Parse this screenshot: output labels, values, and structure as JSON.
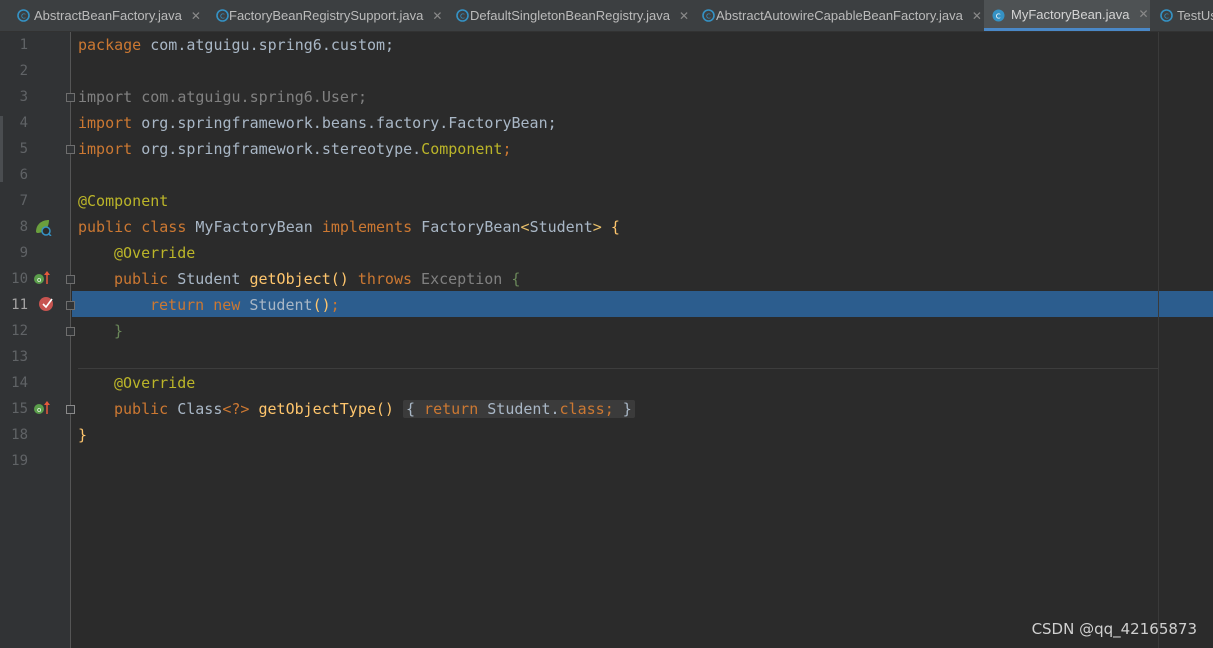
{
  "tabs": [
    {
      "label": "AbstractBeanFactory.java",
      "active": false,
      "close": "✕"
    },
    {
      "label": "FactoryBeanRegistrySupport.java",
      "active": false,
      "close": "✕"
    },
    {
      "label": "DefaultSingletonBeanRegistry.java",
      "active": false,
      "close": "✕"
    },
    {
      "label": "AbstractAutowireCapableBeanFactory.java",
      "active": false,
      "close": "✕"
    },
    {
      "label": "MyFactoryBean.java",
      "active": true,
      "close": "✕"
    },
    {
      "label": "TestUs",
      "active": false,
      "close": ""
    }
  ],
  "line_numbers": [
    "1",
    "2",
    "3",
    "4",
    "5",
    "6",
    "7",
    "8",
    "9",
    "10",
    "11",
    "12",
    "13",
    "14",
    "15",
    "18",
    "19"
  ],
  "current_line": "11",
  "code": {
    "l1": {
      "kw": "package",
      "rest": " com.atguigu.spring6.custom;"
    },
    "l3": {
      "text": "import com.atguigu.spring6.User;"
    },
    "l4": {
      "kw": "import",
      "rest": " org.springframework.beans.factory.FactoryBean;"
    },
    "l5": {
      "kw": "import",
      "rest": " org.springframework.stereotype.",
      "cls": "Component",
      "end": ";"
    },
    "l7": {
      "ann": "@Component"
    },
    "l8": {
      "kw1": "public class",
      "name": " MyFactoryBean ",
      "kw2": "implements",
      "type": " FactoryBean",
      "lt": "<",
      "generic": "Student",
      "gt": ">",
      "brace": " {"
    },
    "l9": {
      "ann": "@Override"
    },
    "l10": {
      "kw": "public",
      "type": " Student ",
      "fn": "getObject",
      "paren": "()",
      "kw2": " throws",
      "exc": " Exception",
      "brace": " {"
    },
    "l11": {
      "kw": "return new",
      "type": " Student",
      "paren": "()",
      "end": ";"
    },
    "l12": {
      "brace": "}"
    },
    "l14": {
      "ann": "@Override"
    },
    "l15": {
      "kw": "public",
      "type": " Class",
      "generic": "<?>",
      "fn": " getObjectType",
      "paren": "()",
      "ob": "{",
      "kw2": " return",
      "type2": " Student.",
      "kw3": "class",
      "end": ";",
      "cb": "}"
    },
    "l18": {
      "brace": "}"
    }
  },
  "colors": {
    "keyword": "#cc7832",
    "annotation": "#bbb529",
    "method": "#ffc66d",
    "text": "#a9b7c6",
    "current_line_bg": "#2c5d8e",
    "tab_active_underline": "#4a88c7"
  },
  "watermark": "CSDN @qq_42165873"
}
